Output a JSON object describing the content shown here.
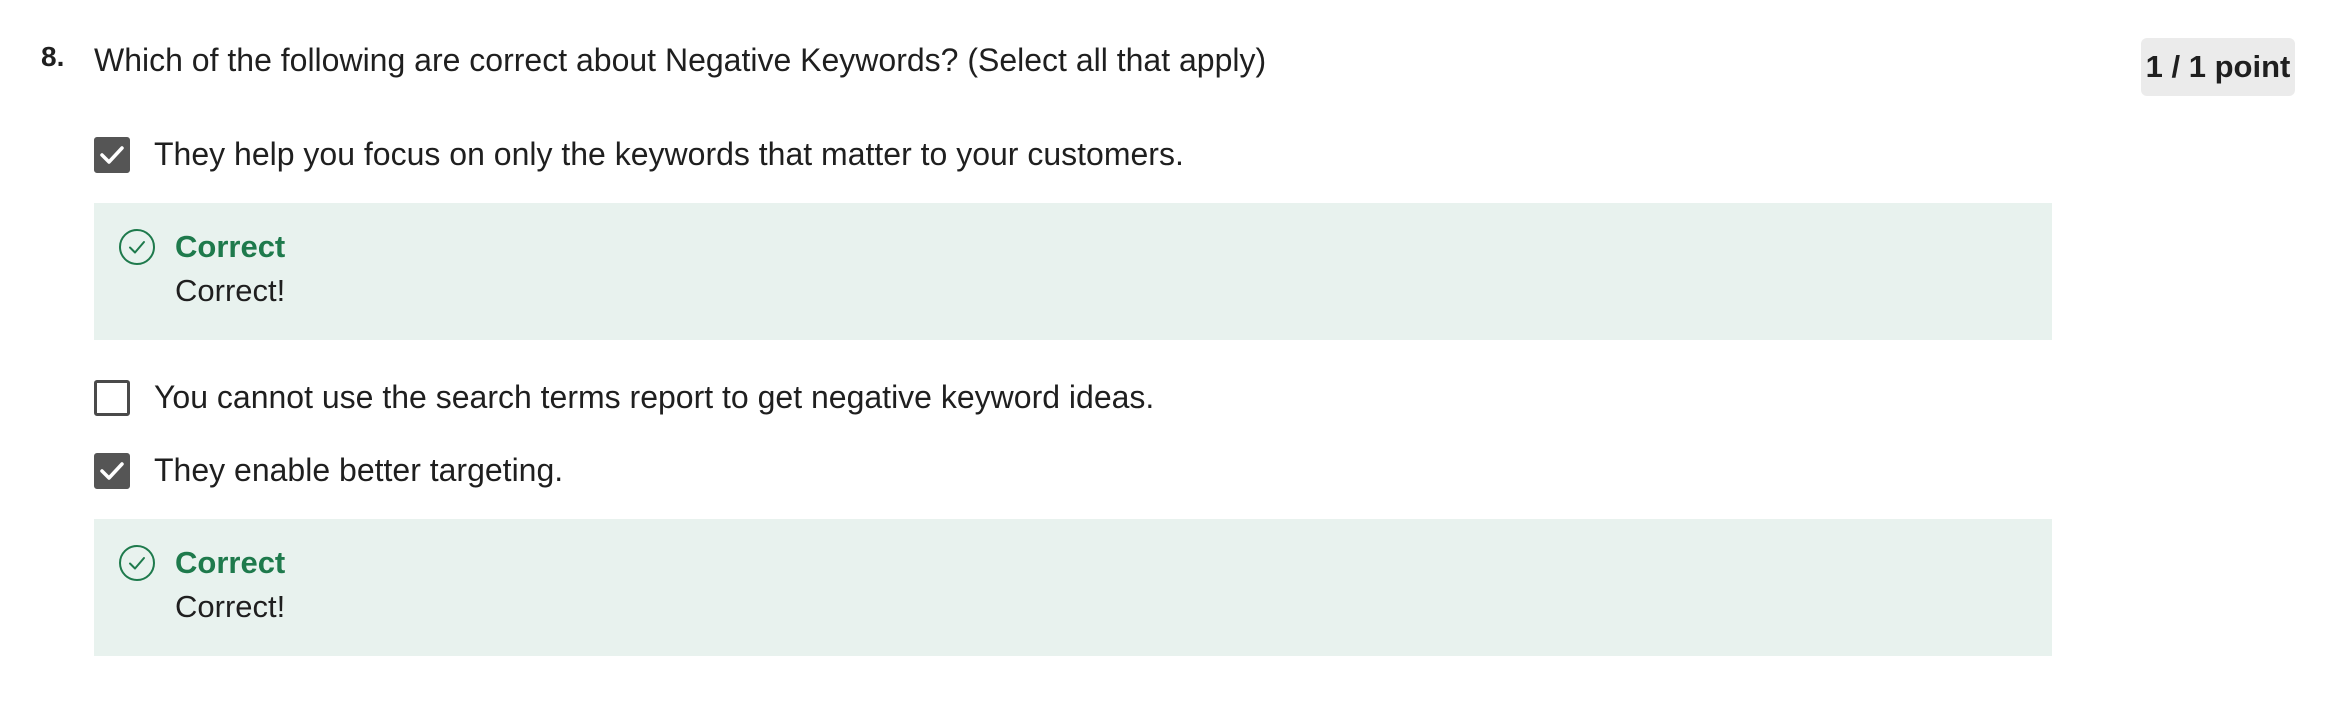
{
  "question": {
    "number": "8.",
    "text": "Which of the following are correct about Negative Keywords? (Select all that apply)",
    "score": "1 / 1 point"
  },
  "options": [
    {
      "label": "They help you focus on only the keywords that matter to your customers.",
      "checked": true,
      "feedback": {
        "title": "Correct",
        "text": "Correct!"
      }
    },
    {
      "label": "You cannot use the search terms report to get negative keyword ideas.",
      "checked": false
    },
    {
      "label": "They enable better targeting.",
      "checked": true,
      "feedback": {
        "title": "Correct",
        "text": "Correct!"
      }
    }
  ],
  "colors": {
    "feedback_background": "#e8f2ee",
    "correct_green": "#1e7a4c",
    "checkbox_checked": "#555555",
    "score_badge_background": "#ebebeb"
  },
  "icons": {
    "checkbox_checked": "check-icon",
    "feedback": "check-circle-icon"
  }
}
